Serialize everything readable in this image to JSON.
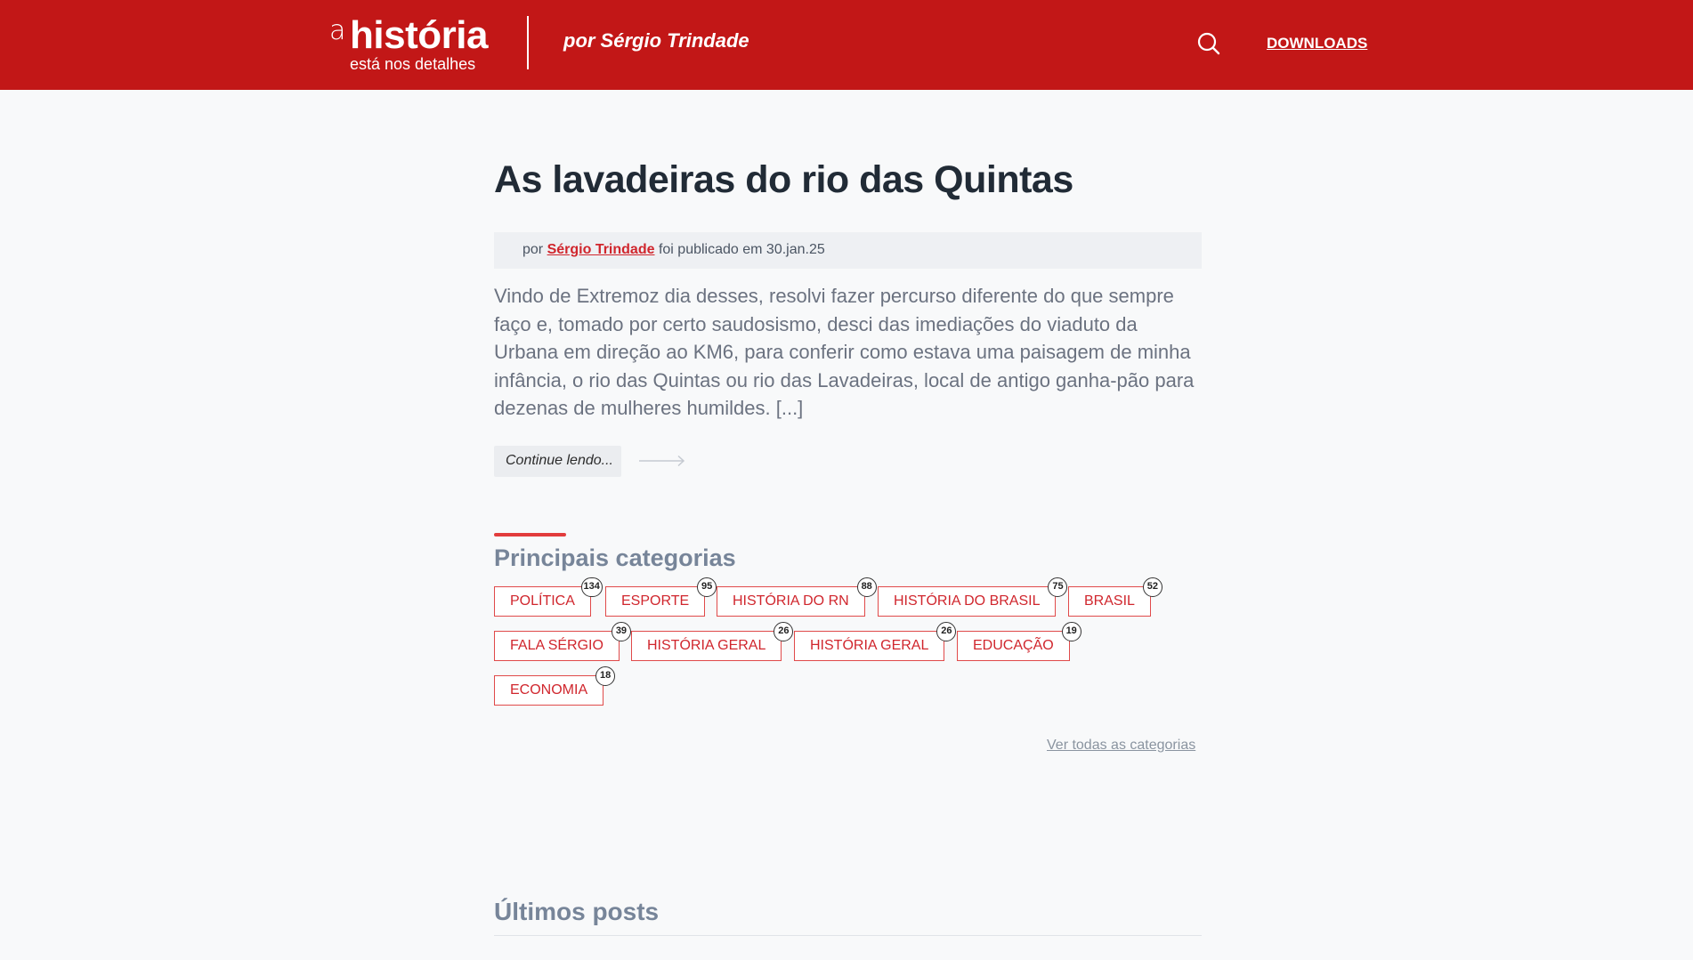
{
  "header": {
    "logo_a": "a",
    "logo_title": "história",
    "logo_subtitle": "está nos detalhes",
    "byline": "por Sérgio Trindade",
    "search_icon": "search-icon",
    "downloads": "DOWNLOADS"
  },
  "colors": {
    "brand": "#c21717",
    "accent": "#d0262d",
    "tag_border": "#e04a4a"
  },
  "article": {
    "title": "As lavadeiras do rio das Quintas",
    "meta_prefix": "por",
    "author": "Sérgio Trindade",
    "meta_middle": "foi publicado em",
    "date": "30.jan.25",
    "excerpt": "Vindo de Extremoz dia desses, resolvi fazer percurso diferente do que sempre faço e, tomado por certo saudosismo, desci das imediações do viaduto da Urbana em direção ao KM6, para conferir como estava uma paisagem de minha infância, o rio das Quintas ou rio das Lavadeiras, local de antigo ganha-pão para dezenas de mulheres humildes. [...]",
    "continue_label": "Continue lendo...",
    "arrow_icon": "arrow-right-icon"
  },
  "categories": {
    "heading": "Principais categorias",
    "items": [
      {
        "label": "POLÍTICA",
        "count": "134"
      },
      {
        "label": "ESPORTE",
        "count": "95"
      },
      {
        "label": "HISTÓRIA DO RN",
        "count": "88"
      },
      {
        "label": "HISTÓRIA DO BRASIL",
        "count": "75"
      },
      {
        "label": "BRASIL",
        "count": "52"
      },
      {
        "label": "FALA SÉRGIO",
        "count": "39"
      },
      {
        "label": "HISTÓRIA GERAL",
        "count": "26"
      },
      {
        "label": "HISTÓRIA GERAL",
        "count": "26"
      },
      {
        "label": "EDUCAÇÃO",
        "count": "19"
      },
      {
        "label": "ECONOMIA",
        "count": "18"
      }
    ],
    "see_all": "Ver todas as categorias"
  },
  "latest": {
    "heading": "Últimos posts"
  }
}
